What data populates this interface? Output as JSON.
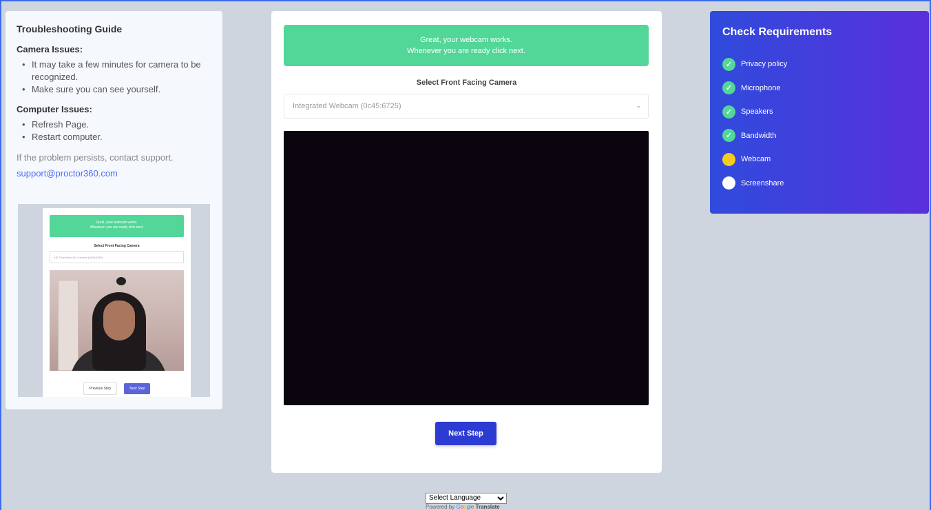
{
  "guide": {
    "title": "Troubleshooting Guide",
    "camera_heading": "Camera Issues:",
    "camera_items": [
      "It may take a few minutes for camera to be recognized.",
      "Make sure you can see yourself."
    ],
    "computer_heading": "Computer Issues:",
    "computer_items": [
      "Refresh Page.",
      "Restart computer."
    ],
    "contact_text": "If the problem persists, contact support.",
    "support_email": "support@proctor360.com",
    "thumbnail": {
      "banner_line1": "Great, your webcam works.",
      "banner_line2": "Whenever you are ready click next.",
      "label": "Select Front Facing Camera",
      "select_value": "HP TrueVision HD Camera (0408:5365)",
      "prev_label": "Previous Step",
      "next_label": "Next Step"
    }
  },
  "main": {
    "banner_line1": "Great, your webcam works.",
    "banner_line2": "Whenever you are ready click next.",
    "camera_label": "Select Front Facing Camera",
    "camera_value": "Integrated Webcam (0c45:6725)",
    "next_label": "Next Step"
  },
  "requirements": {
    "title": "Check Requirements",
    "items": [
      {
        "label": "Privacy policy",
        "status": "done"
      },
      {
        "label": "Microphone",
        "status": "done"
      },
      {
        "label": "Speakers",
        "status": "done"
      },
      {
        "label": "Bandwidth",
        "status": "done"
      },
      {
        "label": "Webcam",
        "status": "current"
      },
      {
        "label": "Screenshare",
        "status": "pending"
      }
    ]
  },
  "translate": {
    "select_label": "Select Language",
    "powered_by": "Powered by",
    "google_letters": [
      "G",
      "o",
      "o",
      "g",
      "l",
      "e"
    ],
    "translate_word": "Translate"
  },
  "colors": {
    "accent": "#2c3bd1",
    "success": "#52d798",
    "warning": "#f8cc1e",
    "border": "#3b6cf0"
  }
}
